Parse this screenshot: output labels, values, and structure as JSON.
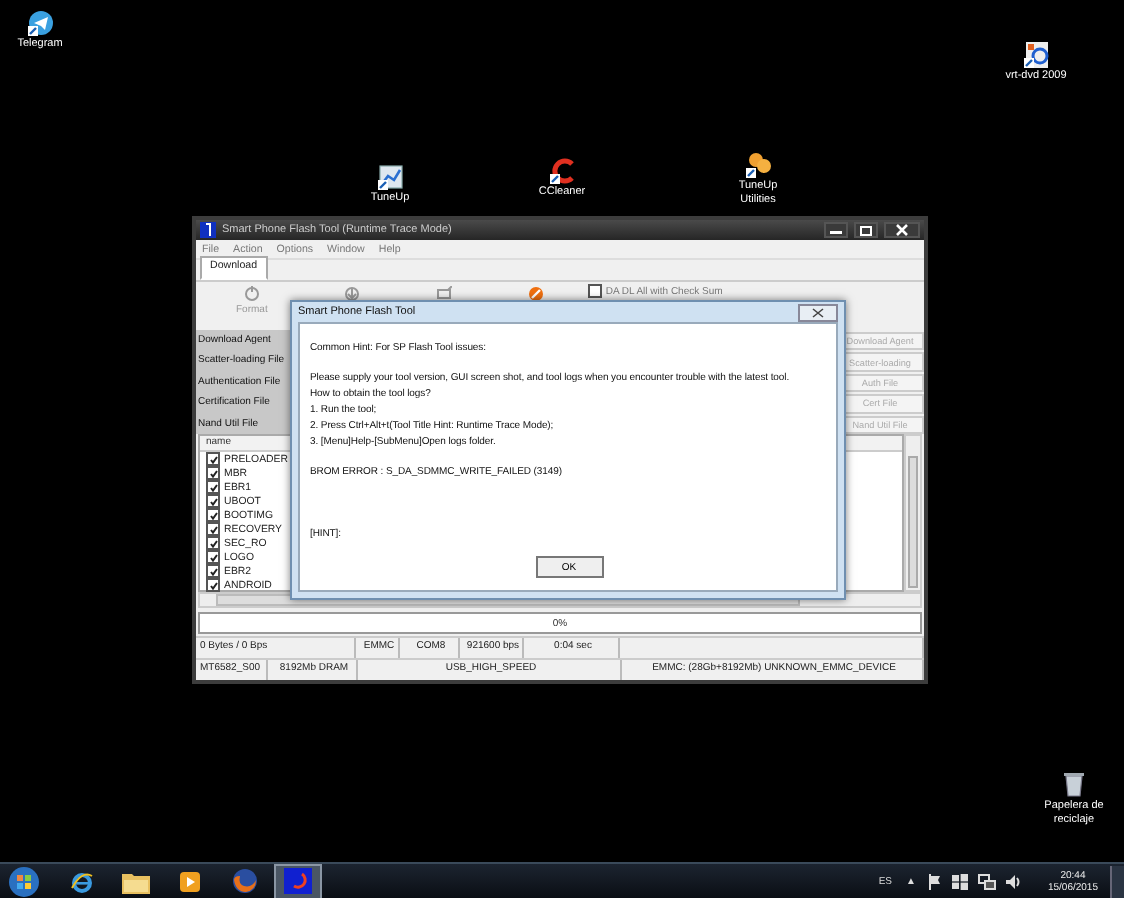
{
  "desktop_icons": [
    {
      "label": "Telegram",
      "kind": "telegram"
    },
    {
      "label": "vrt-dvd 2009",
      "kind": "dvd"
    },
    {
      "label": "TuneUp",
      "kind": "monitor"
    },
    {
      "label": "CCleaner",
      "kind": "ccleaner"
    },
    {
      "label": "TuneUp Utilities",
      "kind": "tuneup"
    },
    {
      "label": "Papelera de reciclaje",
      "kind": "bin"
    }
  ],
  "window": {
    "title": "Smart Phone Flash Tool (Runtime Trace Mode)",
    "menu": [
      "File",
      "Action",
      "Options",
      "Window",
      "Help"
    ],
    "tabs": [
      {
        "label": "Download",
        "selected": true
      }
    ],
    "toolbar": [
      {
        "label": "Format",
        "kind": "format"
      },
      {
        "kind": "download"
      },
      {
        "kind": "upgrade"
      },
      {
        "kind": "stop"
      }
    ],
    "checksum": {
      "label": "DA DL All with Check Sum",
      "checked": false
    },
    "file_labels": [
      "Download Agent",
      "Scatter-loading File",
      "Authentication File",
      "Certification File",
      "Nand Util File"
    ],
    "file_buttons": [
      "Download Agent",
      "Scatter-loading",
      "Auth File",
      "Cert File",
      "Nand Util File"
    ],
    "list_header": "name",
    "partitions": [
      {
        "name": "PRELOADER",
        "checked": true
      },
      {
        "name": "MBR",
        "checked": true
      },
      {
        "name": "EBR1",
        "checked": true
      },
      {
        "name": "UBOOT",
        "checked": true
      },
      {
        "name": "BOOTIMG",
        "checked": true
      },
      {
        "name": "RECOVERY",
        "checked": true
      },
      {
        "name": "SEC_RO",
        "checked": true
      },
      {
        "name": "LOGO",
        "checked": true
      },
      {
        "name": "EBR2",
        "checked": true
      },
      {
        "name": "ANDROID",
        "checked": true
      }
    ],
    "progress": {
      "label": "0%",
      "level": 0
    },
    "status_top": [
      "0 Bytes / 0 Bps",
      "EMMC",
      "COM8",
      "921600 bps",
      "0:04 sec"
    ],
    "status_bottom": [
      "MT6582_S00",
      "8192Mb DRAM",
      "USB_HIGH_SPEED",
      "EMMC: (28Gb+8192Mb) UNKNOWN_EMMC_DEVICE"
    ]
  },
  "dialog": {
    "title": "Smart Phone Flash Tool",
    "paragraphs": [
      [
        "Common Hint: For SP Flash Tool issues:"
      ],
      [
        "Please supply your tool version, GUI screen shot, and tool logs when you encounter trouble with the latest tool.",
        "How to obtain the tool logs?",
        "1. Run the tool;",
        "2. Press Ctrl+Alt+t(Tool Title Hint: Runtime Trace Mode);",
        "3. [Menu]Help-[SubMenu]Open logs folder."
      ],
      [
        "BROM ERROR : S_DA_SDMMC_WRITE_FAILED (3149)"
      ],
      [
        "[HINT]:"
      ]
    ],
    "button": "OK"
  },
  "taskbar": {
    "apps": [
      {
        "kind": "ie",
        "selected": false
      },
      {
        "kind": "folder",
        "selected": false
      },
      {
        "kind": "media",
        "selected": false
      },
      {
        "kind": "firefox",
        "selected": false
      },
      {
        "kind": "flashtool",
        "selected": true
      }
    ],
    "tray": {
      "language": "ES",
      "expand": "▲",
      "time": "20:44",
      "date": "15/06/2015"
    }
  }
}
